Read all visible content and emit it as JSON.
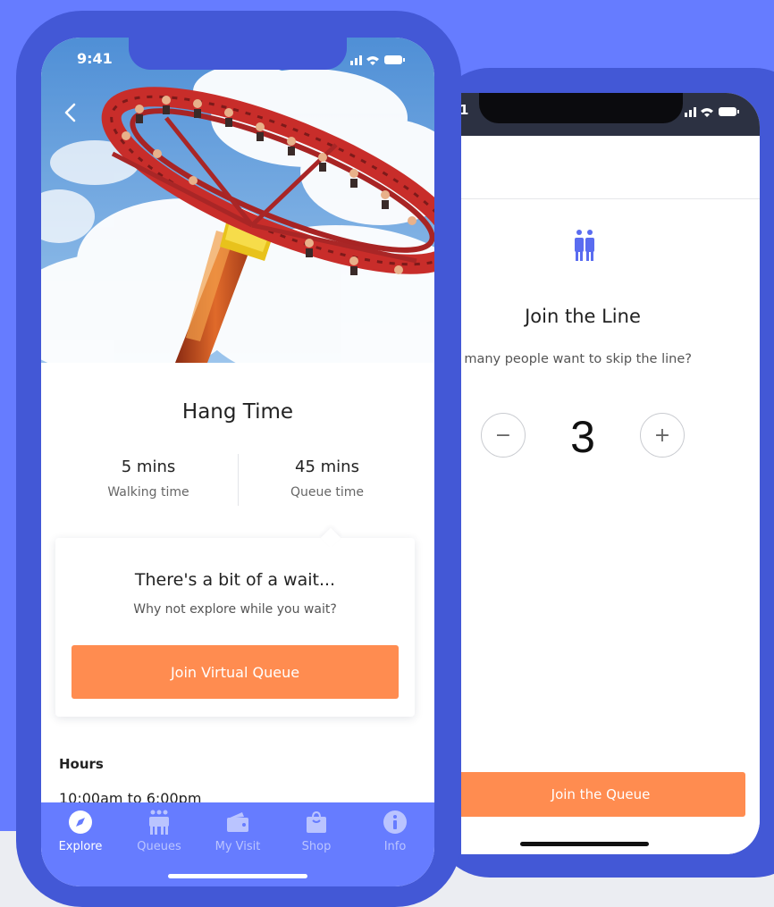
{
  "colors": {
    "background": "#667cff",
    "frame": "#4358d6",
    "accent": "#ff8c50",
    "icon": "#5a6cf0"
  },
  "back_screen": {
    "status_time": "1",
    "title": "Join the Line",
    "question": "ow many people want to skip the line?",
    "party_size": "3",
    "decrement_symbol": "−",
    "increment_symbol": "+",
    "cta_label": "Join the Queue"
  },
  "front_screen": {
    "status_time": "9:41",
    "ride_name": "Hang Time",
    "walking": {
      "value": "5 mins",
      "label": "Walking time"
    },
    "queue": {
      "value": "45 mins",
      "label": "Queue time"
    },
    "wait_card": {
      "title": "There's a bit of a wait...",
      "subtitle": "Why not explore while you wait?",
      "button_label": "Join Virtual Queue"
    },
    "hours": {
      "label": "Hours",
      "value": "10:00am to 6:00pm"
    },
    "tabs": [
      {
        "label": "Explore",
        "icon": "compass-icon",
        "active": true
      },
      {
        "label": "Queues",
        "icon": "people-icon",
        "active": false
      },
      {
        "label": "My Visit",
        "icon": "wallet-icon",
        "active": false
      },
      {
        "label": "Shop",
        "icon": "shopping-bag-icon",
        "active": false
      },
      {
        "label": "Info",
        "icon": "info-icon",
        "active": false
      }
    ]
  }
}
